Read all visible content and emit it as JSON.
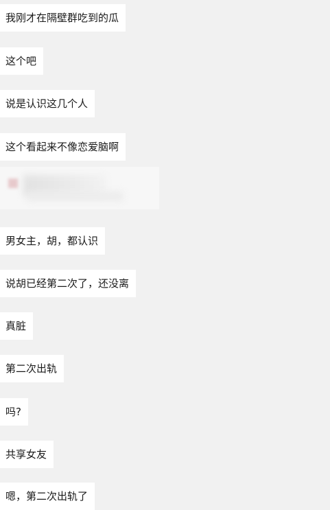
{
  "colors": {
    "background": "#f1f1f1",
    "bubble": "#ffffff",
    "text": "#1a1a1a"
  },
  "messages": [
    {
      "text": "我刚才在隔壁群吃到的瓜"
    },
    {
      "text": "这个吧"
    },
    {
      "text": "说是认识这几个人"
    },
    {
      "text": "这个看起来不像恋爱脑啊"
    },
    {
      "type": "shared-link-card",
      "icon": "document-icon"
    },
    {
      "text": "男女主，胡，都认识"
    },
    {
      "text": "说胡已经第二次了，还没离"
    },
    {
      "text": "真脏"
    },
    {
      "text": "第二次出轨"
    },
    {
      "text": "吗?"
    },
    {
      "text": "共享女友"
    },
    {
      "text": "嗯，第二次出轨了"
    }
  ]
}
